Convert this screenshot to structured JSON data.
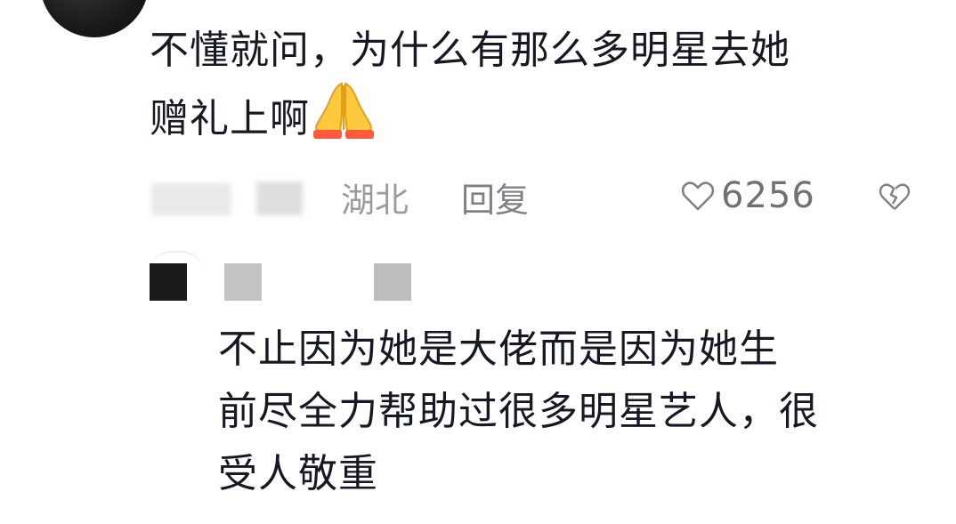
{
  "comment": {
    "text_line1": "不懂就问，为什么有那么多明星去她",
    "text_line2": "赠礼上啊",
    "emoji": "folded-hands-emoji",
    "location": "湖北",
    "reply_label": "回复",
    "like_count": "6256"
  },
  "reply": {
    "text_line1": "不止因为她是大佬而是因为她生",
    "text_line2": "前尽全力帮助过很多明星艺人，很",
    "text_line3": "受人敬重"
  },
  "colors": {
    "text": "#161823",
    "meta_gray": "#9b9ca1",
    "emoji_yellow": "#ffc83d",
    "emoji_cuff": "#ff5a3c"
  }
}
